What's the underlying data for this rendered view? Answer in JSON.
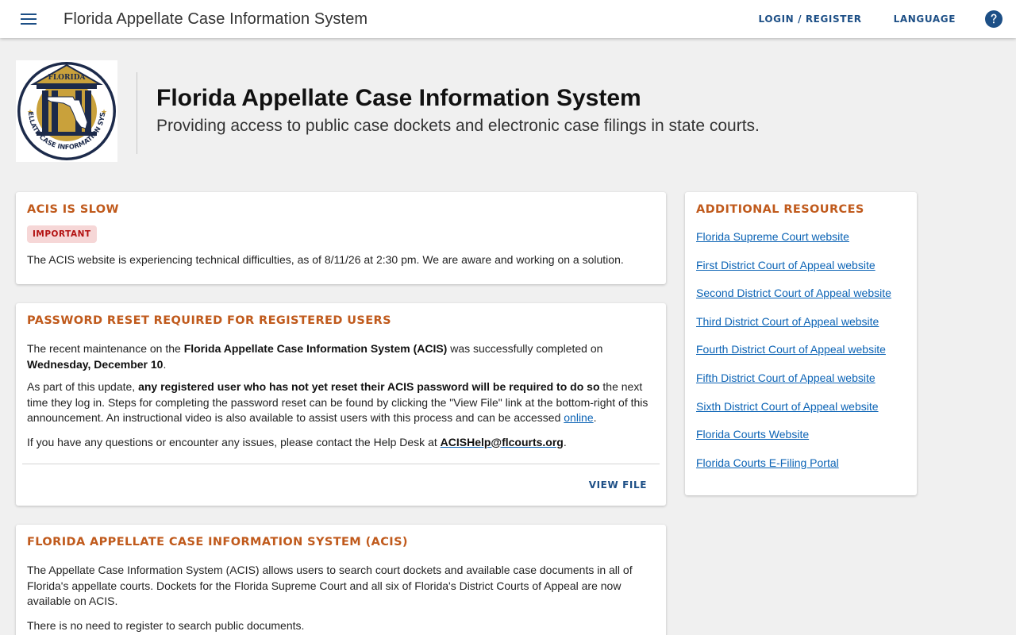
{
  "appbar": {
    "title": "Florida Appellate Case Information System",
    "login_label": "LOGIN / REGISTER",
    "language_label": "LANGUAGE",
    "menu_icon": "hamburger-menu-icon",
    "help_icon": "help-circle-icon",
    "accent": "#1d4f86"
  },
  "hero": {
    "title": "Florida Appellate Case Information System",
    "subtitle": "Providing access to public case dockets and electronic case filings in state courts.",
    "logo_text": {
      "top": "FLORIDA",
      "ring": "APPELLATE CASE INFORMATION SYSTEM"
    }
  },
  "slow_notice": {
    "title": "ACIS IS SLOW",
    "badge": "IMPORTANT",
    "body": "The ACIS website is experiencing technical difficulties, as of 8/11/26 at 2:30 pm. We are aware and working on a solution."
  },
  "password_notice": {
    "title": "PASSWORD RESET REQUIRED FOR REGISTERED USERS",
    "p1_a": "The recent maintenance on the ",
    "p1_b": "Florida Appellate Case Information System (ACIS)",
    "p1_c": " was successfully completed on ",
    "p1_d": "Wednesday, December 10",
    "p1_e": ".",
    "p2_a": "As part of this update, ",
    "p2_b": "any registered user who has not yet reset their ACIS password will be required to do so",
    "p2_c": " the next time they log in. Steps for completing the password reset can be found by clicking the \"View File\" link at the bottom-right of this announcement. An instructional video is also available to assist users with this process and can be accessed ",
    "p2_link": "online",
    "p2_d": ".",
    "p3_a": "If you have any questions or encounter any issues, please contact the Help Desk at ",
    "p3_link": "ACISHelp@flcourts.org",
    "p3_b": ".",
    "view_file": "VIEW FILE"
  },
  "about": {
    "title": "FLORIDA APPELLATE CASE INFORMATION SYSTEM (ACIS)",
    "p1": "The Appellate Case Information System (ACIS) allows users to search court dockets and available case documents in all of Florida's appellate courts. Dockets for the Florida Supreme Court and all six of Florida's District Courts of Appeal are now available on ACIS.",
    "p2": "There is no need to register to search public documents."
  },
  "resources": {
    "title": "ADDITIONAL RESOURCES",
    "links": [
      "Florida Supreme Court website",
      "First District Court of Appeal website",
      "Second District Court of Appeal website",
      "Third District Court of Appeal website",
      "Fourth District Court of Appeal website",
      "Fifth District Court of Appeal website",
      "Sixth District Court of Appeal website",
      "Florida Courts Website",
      "Florida Courts E-Filing Portal"
    ]
  },
  "colors": {
    "heading": "#c05a1c",
    "link": "#0b63b5",
    "badge_bg": "#f6d7d7",
    "badge_text": "#b31212",
    "logo_navy": "#1c2a4a",
    "logo_gold": "#c9a13b"
  }
}
